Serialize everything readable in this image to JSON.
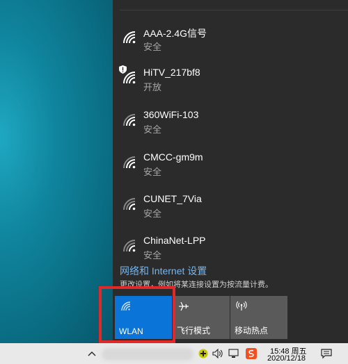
{
  "networks": [
    {
      "name": "AAA-2.4G信号",
      "status": "安全",
      "secured": true
    },
    {
      "name": "HiTV_217bf8",
      "status": "开放",
      "secured": false
    },
    {
      "name": "360WiFi-103",
      "status": "安全",
      "secured": true
    },
    {
      "name": "CMCC-gm9m",
      "status": "安全",
      "secured": true
    },
    {
      "name": "CUNET_7Via",
      "status": "安全",
      "secured": true
    },
    {
      "name": "ChinaNet-LPP",
      "status": "安全",
      "secured": true
    }
  ],
  "settings": {
    "link": "网络和 Internet 设置",
    "description": "更改设置，例如将某连接设置为按流量计费。"
  },
  "quick_actions": [
    {
      "label": "WLAN",
      "icon": "wifi-icon",
      "active": true
    },
    {
      "label": "飞行模式",
      "icon": "airplane-icon",
      "active": false
    },
    {
      "label": "移动热点",
      "icon": "hotspot-icon",
      "active": false
    }
  ],
  "taskbar": {
    "time": "15:48 周五",
    "date": "2020/12/18",
    "icons": [
      "chevron-up-icon",
      "plus-app-icon",
      "volume-icon",
      "network-icon",
      "ime-icon",
      "notification-icon"
    ]
  },
  "colors": {
    "active_tile": "#0a74d8",
    "link": "#73b6f0",
    "highlight_box": "#e02a2a"
  }
}
